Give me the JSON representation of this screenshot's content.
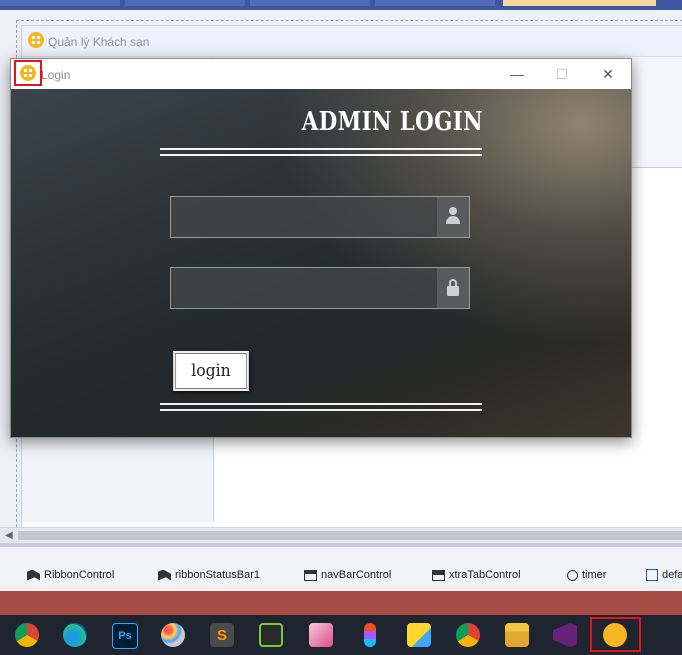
{
  "designer": {
    "form_title": "Quản lý Khách sạn"
  },
  "dialog": {
    "title": "Login",
    "heading": "ADMIN LOGIN",
    "username_value": "",
    "password_value": "",
    "login_label": "login",
    "controls": {
      "minimize": "—",
      "maximize": "☐",
      "close": "✕"
    }
  },
  "tray": {
    "items": [
      "RibbonControl",
      "ribbonStatusBar1",
      "navBarControl",
      "xtraTabControl",
      "timer",
      "defa"
    ]
  },
  "taskbar": {
    "apps": [
      "chrome-icon",
      "edge-icon",
      "photoshop-icon",
      "paint-icon",
      "sublime-icon",
      "terminal-icon",
      "anime-app-icon",
      "figma-icon",
      "sticky-icon",
      "chrome-profile-icon",
      "folder-icon",
      "visual-studio-icon",
      "hotel-app-icon"
    ],
    "ps_label": "Ps",
    "sublime_label": "S"
  },
  "colors": {
    "accent_red": "#e3141a",
    "app_icon": "#f7b520"
  }
}
